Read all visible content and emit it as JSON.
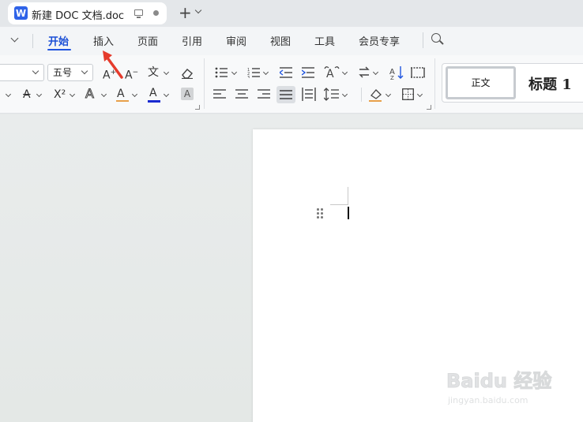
{
  "window": {
    "doc_tab_title": "新建 DOC 文档.doc",
    "app_logo_letter": "W",
    "new_tab_symbol": "+"
  },
  "menu": {
    "tabs": [
      {
        "label": "开始",
        "active": true
      },
      {
        "label": "插入",
        "active": false
      },
      {
        "label": "页面",
        "active": false
      },
      {
        "label": "引用",
        "active": false
      },
      {
        "label": "审阅",
        "active": false
      },
      {
        "label": "视图",
        "active": false
      },
      {
        "label": "工具",
        "active": false
      },
      {
        "label": "会员专享",
        "active": false
      }
    ]
  },
  "ribbon": {
    "font_size_value": "五号",
    "grow_font": "A",
    "shrink_font": "A",
    "pinyin_label": "文",
    "strikethrough_label": "A",
    "superscript_label": "X²",
    "text_effect_label": "A",
    "highlight_label": "A",
    "font_color_label": "A",
    "char_shading_label": "A",
    "styles": {
      "normal": "正文",
      "heading1": "标题 1"
    }
  },
  "watermark": {
    "brand": "Baidu 经验",
    "url": "jingyan.baidu.com"
  },
  "colors": {
    "accent": "#1b4fd6",
    "font_color_underline": "#1a2bd0",
    "arrow": "#e53b2c",
    "app_logo": "#2f63e8"
  }
}
